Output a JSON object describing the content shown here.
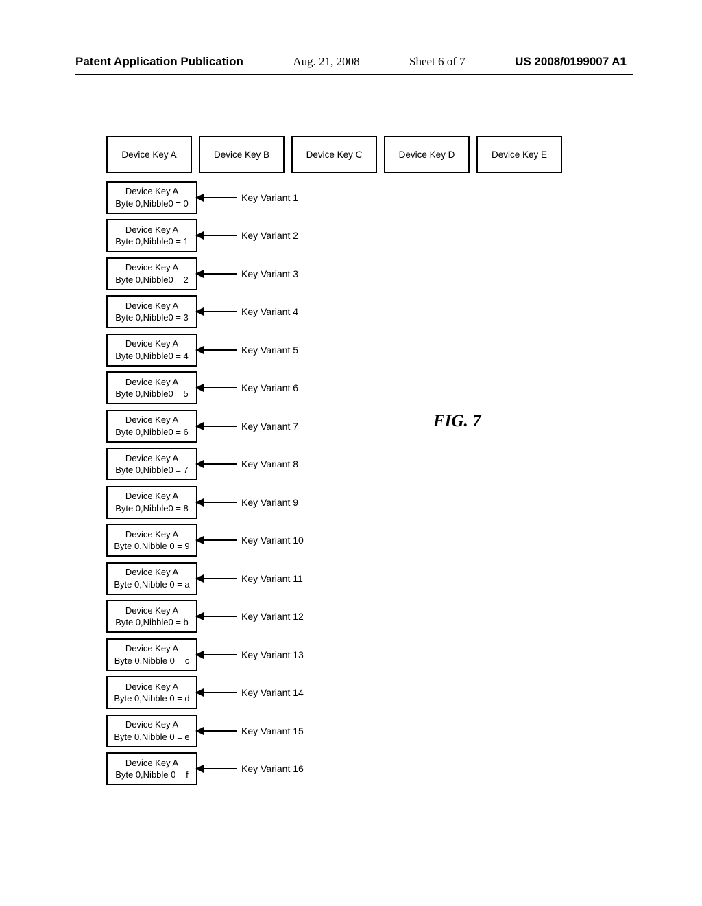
{
  "header": {
    "pub_label": "Patent Application Publication",
    "date": "Aug. 21, 2008",
    "sheet": "Sheet 6 of 7",
    "pub_number": "US 2008/0199007 A1"
  },
  "figure_label": "FIG. 7",
  "device_keys": [
    "Device Key A",
    "Device Key B",
    "Device Key C",
    "Device Key D",
    "Device Key E"
  ],
  "variants": [
    {
      "line1": "Device Key A",
      "line2": "Byte 0,Nibble0 = 0",
      "label": "Key Variant 1"
    },
    {
      "line1": "Device Key A",
      "line2": "Byte 0,Nibble0 = 1",
      "label": "Key Variant 2"
    },
    {
      "line1": "Device Key A",
      "line2": "Byte 0,Nibble0 = 2",
      "label": "Key Variant 3"
    },
    {
      "line1": "Device Key A",
      "line2": "Byte 0,Nibble0 = 3",
      "label": "Key Variant 4"
    },
    {
      "line1": "Device Key A",
      "line2": "Byte 0,Nibble0 = 4",
      "label": "Key Variant 5"
    },
    {
      "line1": "Device Key A",
      "line2": "Byte 0,Nibble0 = 5",
      "label": "Key Variant 6"
    },
    {
      "line1": "Device Key A",
      "line2": "Byte 0,Nibble0 = 6",
      "label": "Key Variant 7"
    },
    {
      "line1": "Device Key A",
      "line2": "Byte 0,Nibble0 = 7",
      "label": "Key Variant 8"
    },
    {
      "line1": "Device Key A",
      "line2": "Byte 0,Nibble0 = 8",
      "label": "Key Variant 9"
    },
    {
      "line1": "Device Key A",
      "line2": "Byte 0,Nibble 0 = 9",
      "label": "Key Variant 10"
    },
    {
      "line1": "Device Key A",
      "line2": "Byte 0,Nibble 0 = a",
      "label": "Key Variant 11"
    },
    {
      "line1": "Device Key A",
      "line2": "Byte 0,Nibble0 = b",
      "label": "Key Variant 12"
    },
    {
      "line1": "Device Key A",
      "line2": "Byte 0,Nibble 0 = c",
      "label": "Key Variant 13"
    },
    {
      "line1": "Device Key A",
      "line2": "Byte 0,Nibble 0 = d",
      "label": "Key Variant 14"
    },
    {
      "line1": "Device Key A",
      "line2": "Byte 0,Nibble 0 = e",
      "label": "Key Variant 15"
    },
    {
      "line1": "Device Key A",
      "line2": "Byte 0,Nibble 0 = f",
      "label": "Key Variant 16"
    }
  ]
}
